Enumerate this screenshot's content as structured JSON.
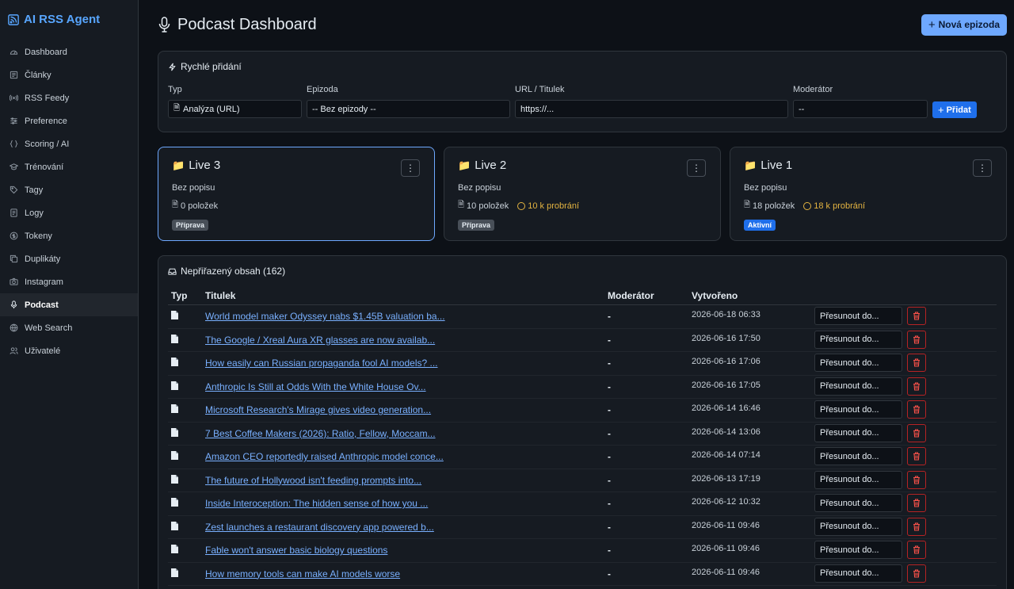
{
  "app": {
    "title": "AI RSS Agent"
  },
  "sidebar": {
    "items": [
      {
        "label": "Dashboard",
        "icon": "gauge-icon"
      },
      {
        "label": "Články",
        "icon": "newspaper-icon"
      },
      {
        "label": "RSS Feedy",
        "icon": "broadcast-icon"
      },
      {
        "label": "Preference",
        "icon": "sliders-icon"
      },
      {
        "label": "Scoring / AI",
        "icon": "braces-icon"
      },
      {
        "label": "Trénování",
        "icon": "graduation-cap-icon"
      },
      {
        "label": "Tagy",
        "icon": "tag-icon"
      },
      {
        "label": "Logy",
        "icon": "file-text-icon"
      },
      {
        "label": "Tokeny",
        "icon": "coin-icon"
      },
      {
        "label": "Duplikáty",
        "icon": "copy-icon"
      },
      {
        "label": "Instagram",
        "icon": "camera-icon"
      },
      {
        "label": "Podcast",
        "icon": "microphone-icon",
        "active": true
      },
      {
        "label": "Web Search",
        "icon": "globe-icon"
      },
      {
        "label": "Uživatelé",
        "icon": "users-icon"
      }
    ]
  },
  "header": {
    "title": "Podcast Dashboard",
    "new_episode_label": "Nová epizoda"
  },
  "quick_add": {
    "title": "Rychlé přidání",
    "type_label": "Typ",
    "type_value": "Analýza (URL)",
    "episode_label": "Epizoda",
    "episode_value": "-- Bez epizody --",
    "url_label": "URL / Titulek",
    "url_placeholder": "https://...",
    "moderator_label": "Moderátor",
    "moderator_value": "--",
    "add_label": "Přidat"
  },
  "episodes": [
    {
      "title": "Live 3",
      "description": "Bez popisu",
      "items": "0 položek",
      "pending": "",
      "status": "Příprava",
      "selected": true
    },
    {
      "title": "Live 2",
      "description": "Bez popisu",
      "items": "10 položek",
      "pending": "10 k probrání",
      "status": "Příprava",
      "selected": false
    },
    {
      "title": "Live 1",
      "description": "Bez popisu",
      "items": "18 položek",
      "pending": "18 k probrání",
      "status": "Aktivní",
      "selected": false
    }
  ],
  "unassigned": {
    "title": "Nepřiřazený obsah (162)",
    "columns": {
      "type": "Typ",
      "title": "Titulek",
      "moderator": "Moderátor",
      "created": "Vytvořeno"
    },
    "move_label": "Přesunout do...",
    "rows": [
      {
        "title": "World model maker Odyssey nabs $1.45B valuation ba...",
        "moderator": "-",
        "created": "2026-06-18 06:33"
      },
      {
        "title": "The Google / Xreal Aura XR glasses are now availab...",
        "moderator": "-",
        "created": "2026-06-16 17:50"
      },
      {
        "title": "How easily can Russian propaganda fool AI models? ...",
        "moderator": "-",
        "created": "2026-06-16 17:06"
      },
      {
        "title": "Anthropic Is Still at Odds With the White House Ov...",
        "moderator": "-",
        "created": "2026-06-16 17:05"
      },
      {
        "title": "Microsoft Research's Mirage gives video generation...",
        "moderator": "-",
        "created": "2026-06-14 16:46"
      },
      {
        "title": "7 Best Coffee Makers (2026): Ratio, Fellow, Moccam...",
        "moderator": "-",
        "created": "2026-06-14 13:06"
      },
      {
        "title": "Amazon CEO reportedly raised Anthropic model conce...",
        "moderator": "-",
        "created": "2026-06-14 07:14"
      },
      {
        "title": "The future of Hollywood isn't feeding prompts into...",
        "moderator": "-",
        "created": "2026-06-13 17:19"
      },
      {
        "title": "Inside Interoception: The hidden sense of how you ...",
        "moderator": "-",
        "created": "2026-06-12 10:32"
      },
      {
        "title": "Zest launches a restaurant discovery app powered b...",
        "moderator": "-",
        "created": "2026-06-11 09:46"
      },
      {
        "title": "Fable won't answer basic biology questions",
        "moderator": "-",
        "created": "2026-06-11 09:46"
      },
      {
        "title": "How memory tools can make AI models worse",
        "moderator": "-",
        "created": "2026-06-11 09:46"
      }
    ]
  },
  "colors": {
    "accent": "#6ea8fe",
    "link": "#79b0ff",
    "warning": "#e3b341",
    "danger": "#f85149",
    "background": "#0d1117",
    "panel": "#161b22"
  }
}
